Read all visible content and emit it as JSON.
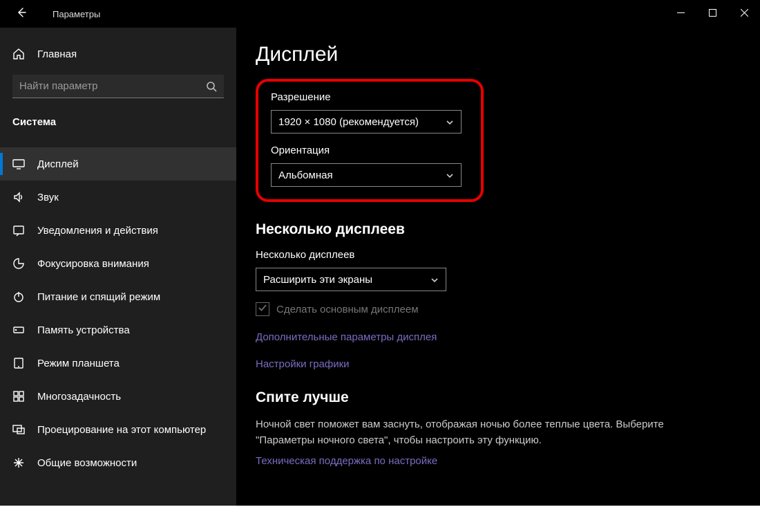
{
  "titlebar": {
    "app_title": "Параметры"
  },
  "sidebar": {
    "home_label": "Главная",
    "search_placeholder": "Найти параметр",
    "category_label": "Система",
    "items": [
      {
        "label": "Дисплей"
      },
      {
        "label": "Звук"
      },
      {
        "label": "Уведомления и действия"
      },
      {
        "label": "Фокусировка внимания"
      },
      {
        "label": "Питание и спящий режим"
      },
      {
        "label": "Память устройства"
      },
      {
        "label": "Режим планшета"
      },
      {
        "label": "Многозадачность"
      },
      {
        "label": "Проецирование на этот компьютер"
      },
      {
        "label": "Общие возможности"
      }
    ]
  },
  "main": {
    "page_title": "Дисплей",
    "resolution": {
      "label": "Разрешение",
      "value": "1920 × 1080 (рекомендуется)"
    },
    "orientation": {
      "label": "Ориентация",
      "value": "Альбомная"
    },
    "multi": {
      "heading": "Несколько дисплеев",
      "label": "Несколько дисплеев",
      "value": "Расширить эти экраны",
      "make_primary": "Сделать основным дисплеем"
    },
    "links": {
      "advanced_display": "Дополнительные параметры дисплея",
      "graphics": "Настройки графики",
      "support": "Техническая поддержка по настройке"
    },
    "sleep": {
      "heading": "Спите лучше",
      "body": "Ночной свет поможет вам заснуть, отображая ночью более теплые цвета. Выберите \"Параметры ночного света\", чтобы настроить эту функцию."
    }
  }
}
